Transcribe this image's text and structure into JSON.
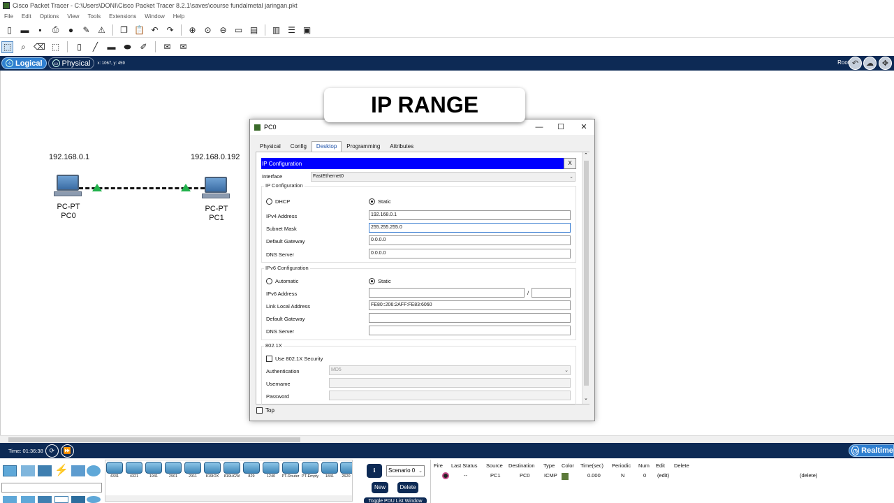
{
  "window": {
    "title": "Cisco Packet Tracer - C:\\Users\\DONI\\Cisco Packet Tracer 8.2.1\\saves\\course fundalmetal jaringan.pkt"
  },
  "menu": [
    "File",
    "Edit",
    "Options",
    "View",
    "Tools",
    "Extensions",
    "Window",
    "Help"
  ],
  "workspace_bar": {
    "logical": "Logical",
    "physical": "Physical",
    "coords": "x: 1067, y: 459",
    "root": "Root"
  },
  "network": {
    "pc0": {
      "ip": "192.168.0.1",
      "type": "PC-PT",
      "name": "PC0"
    },
    "pc1": {
      "ip": "192.168.0.192",
      "type": "PC-PT",
      "name": "PC1"
    }
  },
  "banner": "IP RANGE",
  "dialog": {
    "title": "PC0",
    "tabs": [
      "Physical",
      "Config",
      "Desktop",
      "Programming",
      "Attributes"
    ],
    "active_tab": "Desktop",
    "ip_config_title": "IP Configuration",
    "close_x": "X",
    "interface_label": "Interface",
    "interface_value": "FastEthernet0",
    "ipv4_group": "IP Configuration",
    "dhcp": "DHCP",
    "static": "Static",
    "ipv4_label": "IPv4 Address",
    "ipv4_value": "192.168.0.1",
    "mask_label": "Subnet Mask",
    "mask_value": "255.255.255.0",
    "gw_label": "Default Gateway",
    "gw_value": "0.0.0.0",
    "dns_label": "DNS Server",
    "dns_value": "0.0.0.0",
    "ipv6_group": "IPv6 Configuration",
    "automatic": "Automatic",
    "static6": "Static",
    "ipv6_label": "IPv6 Address",
    "slash": "/",
    "link_local_label": "Link Local Address",
    "link_local_value": "FE80::206:2AFF:FE83:6060",
    "gw6_label": "Default Gateway",
    "dns6_label": "DNS Server",
    "dot1x_group": "802.1X",
    "use_dot1x": "Use 802.1X Security",
    "auth_label": "Authentication",
    "auth_value": "MD5",
    "user_label": "Username",
    "pass_label": "Password",
    "top": "Top"
  },
  "timebar": {
    "time": "Time: 01:36:38",
    "realtime": "Realtime"
  },
  "devices": [
    "4331",
    "4321",
    "1941",
    "2901",
    "2911",
    "819IOX",
    "819HGW",
    "829",
    "1240",
    "PT-Router",
    "PT-Empty",
    "1841",
    "2620"
  ],
  "pdu": {
    "scenario": "Scenario 0",
    "new": "New",
    "delete": "Delete",
    "toggle": "Toggle PDU List Window",
    "headers": [
      "Fire",
      "Last Status",
      "Source",
      "Destination",
      "Type",
      "Color",
      "Time(sec)",
      "Periodic",
      "Num",
      "Edit",
      "Delete"
    ],
    "row": {
      "last_status": "--",
      "source": "PC1",
      "destination": "PC0",
      "type": "ICMP",
      "color": "#5c7a3a",
      "time": "0.000",
      "periodic": "N",
      "num": "0",
      "edit": "(edit)",
      "delete": "(delete)"
    }
  }
}
